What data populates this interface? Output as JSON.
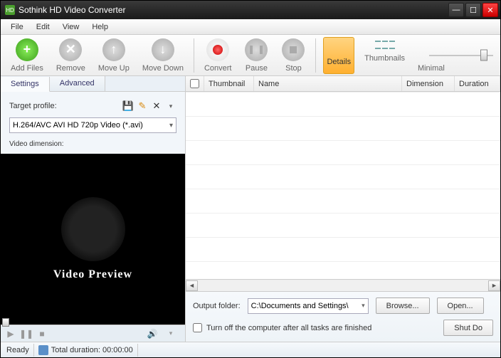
{
  "window": {
    "title": "Sothink HD Video Converter"
  },
  "menu": {
    "file": "File",
    "edit": "Edit",
    "view": "View",
    "help": "Help"
  },
  "toolbar": {
    "add_files": "Add Files",
    "remove": "Remove",
    "move_up": "Move Up",
    "move_down": "Move Down",
    "convert": "Convert",
    "pause": "Pause",
    "stop": "Stop",
    "details": "Details",
    "thumbnails": "Thumbnails",
    "minimal": "Minimal"
  },
  "tabs": {
    "settings": "Settings",
    "advanced": "Advanced"
  },
  "settings": {
    "target_profile_label": "Target profile:",
    "profile_value": "H.264/AVC AVI HD 720p Video (*.avi)",
    "video_dimension_label": "Video dimension:"
  },
  "preview": {
    "text": "Video Preview"
  },
  "table": {
    "thumbnail": "Thumbnail",
    "name": "Name",
    "dimension": "Dimension",
    "duration": "Duration"
  },
  "output": {
    "label": "Output folder:",
    "path": "C:\\Documents and Settings\\",
    "browse": "Browse...",
    "open": "Open...",
    "shutdown_check": "Turn off the computer after all tasks are finished",
    "shut_btn": "Shut Do"
  },
  "status": {
    "ready": "Ready",
    "total_duration": "Total duration: 00:00:00"
  }
}
